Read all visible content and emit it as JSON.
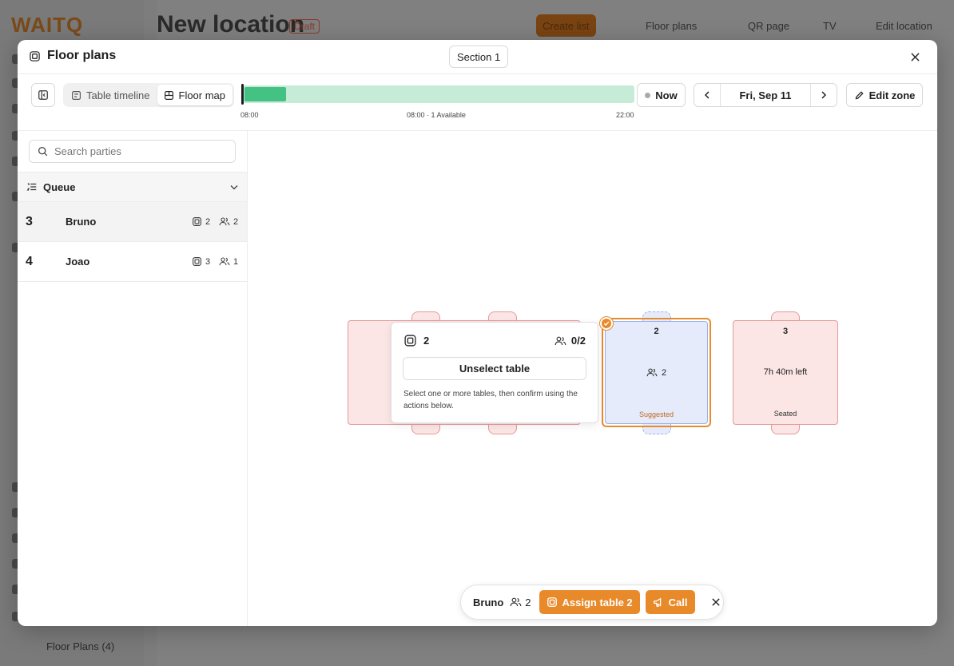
{
  "background": {
    "logo_main": "WAIT",
    "logo_accent": "Q",
    "page_title": "New location",
    "page_badge": "Draft",
    "create_list_label": "Create list",
    "floor_plans_label": "Floor plans",
    "qr_page_label": "QR page",
    "tv_label": "TV",
    "edit_location_label": "Edit location",
    "footer_label": "Floor Plans (4)"
  },
  "modal": {
    "title": "Floor plans",
    "section_label": "Section 1",
    "toolbar": {
      "view_tabs": [
        {
          "label": "Table timeline",
          "icon": "timeline-icon",
          "active": false
        },
        {
          "label": "Floor map",
          "icon": "floor-map-icon",
          "active": true
        }
      ],
      "timeline": {
        "start_label": "08:00",
        "mid_label": "08:00 · 1 Available",
        "end_label": "22:00",
        "fill_fraction": 0.105,
        "track_color": "#c6ecd8",
        "fill_color": "#43c283"
      },
      "now_label": "Now",
      "date_label": "Fri, Sep 11",
      "edit_zone_label": "Edit zone"
    },
    "left_panel": {
      "search_placeholder": "Search parties",
      "queue_label": "Queue",
      "parties": [
        {
          "position": "3",
          "name": "Bruno",
          "tables": "2",
          "guests": "2",
          "selected": true
        },
        {
          "position": "4",
          "name": "Joao",
          "tables": "3",
          "guests": "1",
          "selected": false
        }
      ]
    },
    "map": {
      "tables": [
        {
          "number": "2",
          "capacity": "2",
          "status": "Suggested"
        },
        {
          "number": "3",
          "time_left": "7h 40m left",
          "status": "Seated"
        }
      ],
      "popup": {
        "table_number": "2",
        "occupancy": "0/2",
        "unselect_label": "Unselect table",
        "hint": "Select one or more tables, then confirm using the actions below."
      }
    },
    "action_bar": {
      "party_name": "Bruno",
      "guests": "2",
      "assign_label": "Assign table 2",
      "call_label": "Call"
    }
  },
  "colors": {
    "accent": "#e98a2a",
    "seated_fill": "#fbe5e5",
    "suggested_fill": "#e5ebfb"
  }
}
